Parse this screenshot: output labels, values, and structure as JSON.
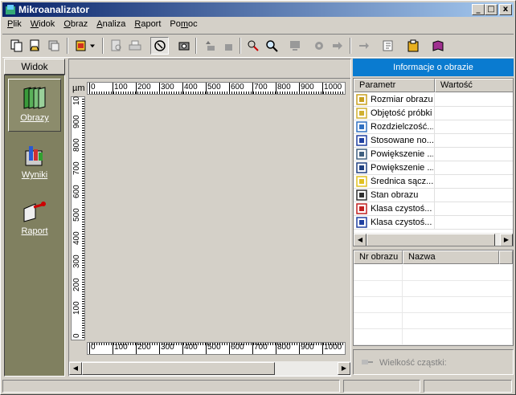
{
  "window": {
    "title": "Mikroanalizator",
    "minimize": "_",
    "maximize": "□",
    "close": "x"
  },
  "menu": [
    {
      "label": "Plik",
      "accel": "P",
      "rest": "lik"
    },
    {
      "label": "Widok",
      "accel": "W",
      "rest": "idok"
    },
    {
      "label": "Obraz",
      "accel": "O",
      "rest": "braz"
    },
    {
      "label": "Analiza",
      "accel": "A",
      "rest": "naliza"
    },
    {
      "label": "Raport",
      "accel": "R",
      "rest": "aport"
    },
    {
      "label": "Pomoc",
      "accel": "m",
      "pre": "Po",
      "rest": "oc"
    }
  ],
  "toolbar": {
    "icons": [
      "copy-icon",
      "open-folder-icon",
      "stack-icon",
      "import-icon",
      "dropdown-arrow-icon",
      "print-preview-icon",
      "print-icon",
      "pointer-select-icon",
      "camera-icon",
      "move-up-icon",
      "move-down-icon",
      "measure-icon",
      "zoom-icon",
      "monitor-icon",
      "settings-icon",
      "forward-icon",
      "export-icon",
      "report-edit-icon",
      "clipboard-icon",
      "book-icon"
    ]
  },
  "left": {
    "header": "Widok",
    "items": [
      {
        "label": "Obrazy",
        "icon": "images-icon",
        "active": true
      },
      {
        "label": "Wyniki",
        "icon": "results-icon",
        "active": false
      },
      {
        "label": "Raport",
        "icon": "report-icon",
        "active": false
      }
    ]
  },
  "image": {
    "unit": "µm",
    "hticks": [
      "0",
      "100",
      "200",
      "300",
      "400",
      "500",
      "600",
      "700",
      "800",
      "900",
      "1000"
    ],
    "vticks": [
      "0",
      "100",
      "200",
      "300",
      "400",
      "500",
      "600",
      "700",
      "800",
      "900",
      "10"
    ]
  },
  "info": {
    "title": "Informacje o obrazie",
    "columns": [
      "Parametr",
      "Wartość"
    ],
    "rows": [
      {
        "label": "Rozmiar obrazu",
        "icon": "image-size-icon",
        "value": ""
      },
      {
        "label": "Objętość próbki",
        "icon": "sample-volume-icon",
        "value": ""
      },
      {
        "label": "Rozdzielczość...",
        "icon": "resolution-icon",
        "value": ""
      },
      {
        "label": "Stosowane no...",
        "icon": "iso-nas-icon",
        "value": ""
      },
      {
        "label": "Powiększenie ...",
        "icon": "magnifier-icon",
        "value": ""
      },
      {
        "label": "Powiększenie ...",
        "icon": "binoculars-icon",
        "value": ""
      },
      {
        "label": "Średnica sącz...",
        "icon": "filter-diameter-icon",
        "value": ""
      },
      {
        "label": "Stan obrazu",
        "icon": "image-state-icon",
        "value": ""
      },
      {
        "label": "Klasa czystoś...",
        "icon": "iso-class-icon",
        "value": ""
      },
      {
        "label": "Klasa czystoś...",
        "icon": "nas-class-icon",
        "value": ""
      }
    ]
  },
  "list": {
    "columns": [
      "Nr obrazu",
      "Nazwa"
    ]
  },
  "particle": {
    "label": "Wielkość cząstki:"
  },
  "colors": {
    "info_header": "#0a7bd0",
    "left_panel": "#808060",
    "title_start": "#0a246a",
    "title_end": "#a6caf0"
  }
}
